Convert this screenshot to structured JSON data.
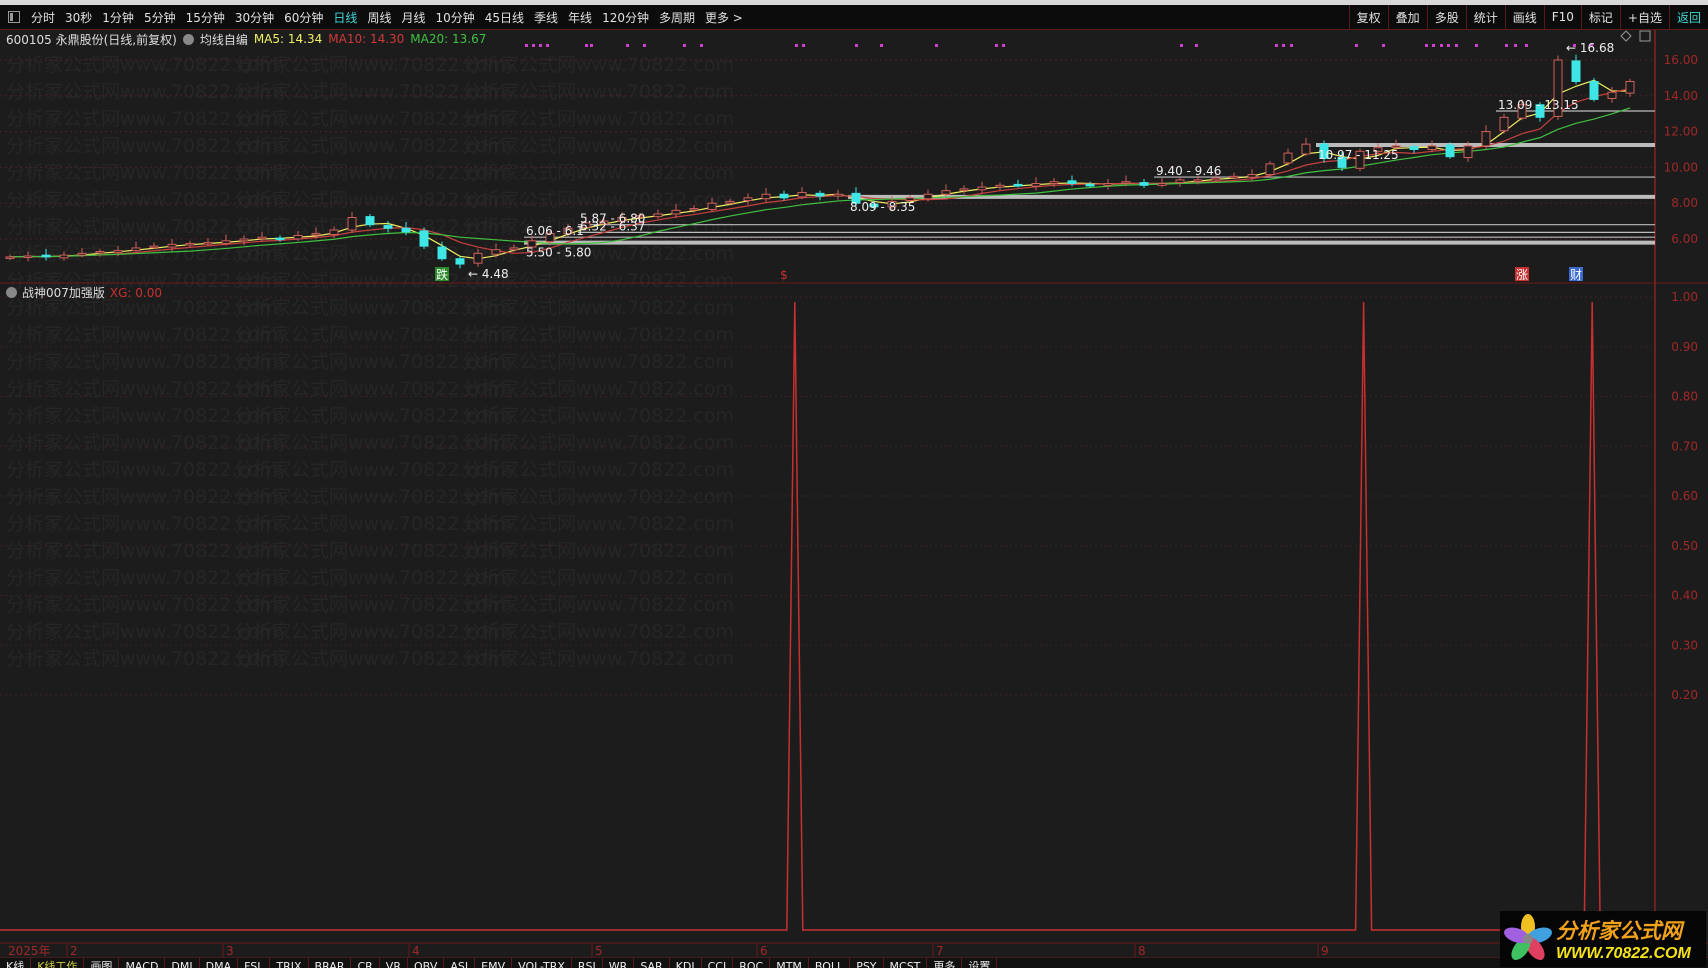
{
  "toolbar": {
    "periods": [
      "分时",
      "30秒",
      "1分钟",
      "5分钟",
      "15分钟",
      "30分钟",
      "60分钟",
      "日线",
      "周线",
      "月线",
      "10分钟",
      "45日线",
      "季线",
      "年线",
      "120分钟",
      "多周期",
      "更多 >"
    ],
    "active_period": "日线",
    "right": [
      "复权",
      "叠加",
      "多股",
      "统计",
      "画线",
      "F10",
      "标记",
      "+自选",
      "返回"
    ]
  },
  "info": {
    "stock": "600105 永鼎股份(日线,前复权)",
    "indicator": "均线自编",
    "ma5": "MA5: 14.34",
    "ma10": "MA10: 14.30",
    "ma20": "MA20: 13.67"
  },
  "indicator_panel": {
    "title": "战神007加强版",
    "xg": "XG: 0.00"
  },
  "watermark": "分析家公式网www.70822.com",
  "time_axis": [
    "2025年",
    "2",
    "3",
    "4",
    "5",
    "6",
    "7",
    "8",
    "9"
  ],
  "bottom_tabs": [
    "K线",
    "K线工作",
    "画图",
    "MACD",
    "DMI",
    "DMA",
    "FSL",
    "TRIX",
    "BRAR",
    "CR",
    "VR",
    "OBV",
    "ASI",
    "EMV",
    "VOL-TRX",
    "RSI",
    "WR",
    "SAR",
    "KDJ",
    "CCI",
    "ROC",
    "MTM",
    "BOLL",
    "PSY",
    "MCST",
    "更多",
    "设置"
  ],
  "logo": {
    "name": "分析家公式网",
    "url": "WWW.70822.COM"
  },
  "colors": {
    "up": "#d0605a",
    "down": "#3ee6e6",
    "ma5": "#f0f060",
    "ma10": "#c84040",
    "ma20": "#40c040",
    "axis": "#a02828",
    "indicator": "#c83030"
  },
  "chart_data": [
    {
      "type": "candlestick",
      "title": "600105 永鼎股份 日线",
      "ylim": [
        4,
        17
      ],
      "yticks": [
        "16.00",
        "14.00",
        "12.00",
        "10.00",
        "8.00",
        "6.00"
      ],
      "closes": [
        5.0,
        5.05,
        5.0,
        5.1,
        5.2,
        5.3,
        5.35,
        5.5,
        5.6,
        5.7,
        5.75,
        5.8,
        5.9,
        6.0,
        6.1,
        6.0,
        6.2,
        6.3,
        6.5,
        7.2,
        6.8,
        6.6,
        6.4,
        5.6,
        4.9,
        4.6,
        5.2,
        5.4,
        5.5,
        5.9,
        6.3,
        6.6,
        6.9,
        7.0,
        7.2,
        7.3,
        7.4,
        7.6,
        7.7,
        8.0,
        8.1,
        8.3,
        8.5,
        8.3,
        8.6,
        8.4,
        8.5,
        8.0,
        7.8,
        8.1,
        8.3,
        8.5,
        8.7,
        8.8,
        8.9,
        9.0,
        9.0,
        9.1,
        9.2,
        9.1,
        9.0,
        9.1,
        9.2,
        9.0,
        9.1,
        9.3,
        9.3,
        9.4,
        9.5,
        9.6,
        10.2,
        10.8,
        11.3,
        10.5,
        10.0,
        10.9,
        11.1,
        11.2,
        11.0,
        11.2,
        10.6,
        11.2,
        12.0,
        12.8,
        13.5,
        12.8,
        16.0,
        14.8,
        13.8,
        14.2,
        14.8
      ],
      "levels": [
        {
          "label": "5.50 - 5.80",
          "value": 5.8,
          "thick": true,
          "start": 29
        },
        {
          "label": "6.06 - 6.1",
          "value": 6.1,
          "thick": false,
          "start": 29
        },
        {
          "label": "6.32 - 6.37",
          "value": 6.37,
          "thick": false,
          "start": 32
        },
        {
          "label": "5.87 - 6.80",
          "value": 6.8,
          "thick": false,
          "start": 32
        },
        {
          "label": "8.09 - 8.35",
          "value": 8.35,
          "thick": true,
          "start": 47
        },
        {
          "label": "9.40 - 9.46",
          "value": 9.46,
          "thick": false,
          "start": 64
        },
        {
          "label": "10.97 - 11.25",
          "value": 11.25,
          "thick": true,
          "start": 73
        },
        {
          "label": "13.09 - 13.15",
          "value": 13.15,
          "thick": false,
          "start": 83
        }
      ],
      "annotations": [
        {
          "label": "4.48",
          "index": 25,
          "value": 4.48
        },
        {
          "label": "16.68",
          "index": 86,
          "value": 16.68
        }
      ],
      "markers": [
        {
          "label": "跌",
          "index": 24,
          "color": "#2a8a2a"
        },
        {
          "label": "$",
          "index": 43,
          "color": "#c83030"
        },
        {
          "label": "涨",
          "index": 84,
          "color": "#c83030"
        },
        {
          "label": "财",
          "index": 87,
          "color": "#3a6ad0"
        }
      ]
    },
    {
      "type": "line",
      "title": "战神007加强版",
      "ylim": [
        0,
        1
      ],
      "yticks": [
        "1.00",
        "0.90",
        "0.80",
        "0.70",
        "0.60",
        "0.50",
        "0.40",
        "0.30",
        "0.20"
      ],
      "spikes": [
        {
          "index": 43.6,
          "value": 1
        },
        {
          "index": 75.2,
          "value": 1
        },
        {
          "index": 87.9,
          "value": 1
        }
      ]
    }
  ]
}
